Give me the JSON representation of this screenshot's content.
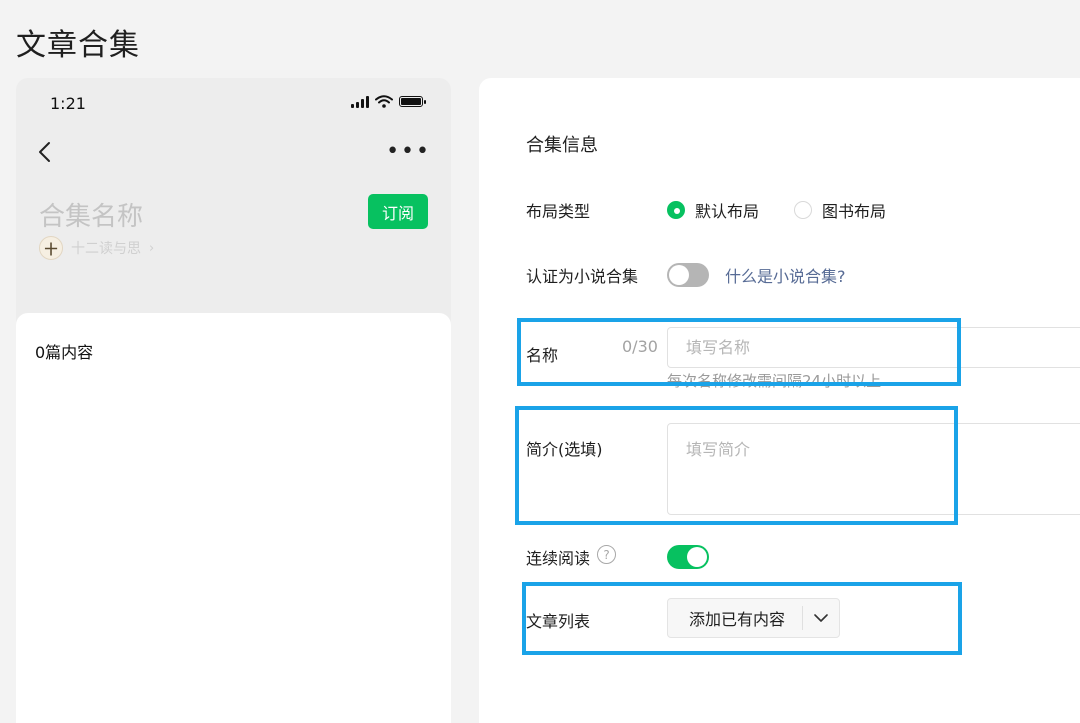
{
  "page": {
    "title": "文章合集"
  },
  "phone": {
    "status_time": "1:21",
    "collection_name_placeholder": "合集名称",
    "subscribe_label": "订阅",
    "author_avatar_char": "十",
    "author_name": "十二读与思",
    "author_chevron": "›",
    "more_glyph": "•••",
    "article_count": "0篇内容"
  },
  "form": {
    "section_title": "合集信息",
    "layout_label": "布局类型",
    "layout_options": [
      {
        "label": "默认布局",
        "selected": true
      },
      {
        "label": "图书布局",
        "selected": false
      }
    ],
    "novel_label": "认证为小说合集",
    "novel_enabled": false,
    "novel_link": "什么是小说合集?",
    "name_label": "名称",
    "name_counter": "0/30",
    "name_placeholder": "填写名称",
    "name_hint": "每次名称修改需间隔24小时以上",
    "intro_label": "简介(选填)",
    "intro_placeholder": "填写简介",
    "continuous_label": "连续阅读",
    "continuous_help": "?",
    "continuous_enabled": true,
    "articles_label": "文章列表",
    "add_existing_label": "添加已有内容"
  },
  "colors": {
    "accent": "#07c160",
    "link": "#576b95",
    "highlight": "#1aa3e8"
  },
  "icons": [
    "back-icon",
    "more-icon",
    "signal-icon",
    "wifi-icon",
    "battery-icon",
    "help-icon",
    "chevron-down-icon"
  ]
}
